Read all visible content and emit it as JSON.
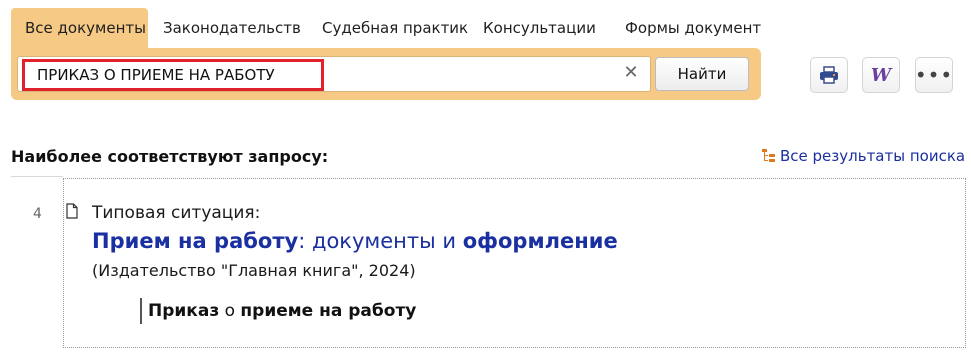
{
  "tabs": [
    {
      "label": "Все документы",
      "active": true
    },
    {
      "label": "Законодательств",
      "active": false
    },
    {
      "label": "Судебная практик",
      "active": false
    },
    {
      "label": "Консультации",
      "active": false
    },
    {
      "label": "Формы документ",
      "active": false
    }
  ],
  "search": {
    "value": "ПРИКАЗ О ПРИЕМЕ НА РАБОТУ",
    "clear_icon": "close-icon",
    "find_label": "Найти"
  },
  "toolbar": {
    "print_icon": "printer-icon",
    "word_icon": "word-export-icon",
    "word_glyph": "W",
    "more_icon": "more-dots-icon",
    "more_glyph": "•••"
  },
  "results": {
    "title": "Наиболее соответствуют запросу:",
    "all_results_label": "Все результаты поиска",
    "items": [
      {
        "number": "4",
        "kind": "Типовая ситуация:",
        "title_parts": [
          {
            "text": "Прием на работу",
            "bold": true
          },
          {
            "text": ": документы и ",
            "bold": false
          },
          {
            "text": "оформление",
            "bold": true
          }
        ],
        "source": "(Издательство \"Главная книга\", 2024)",
        "fragment_parts": [
          {
            "text": "Приказ",
            "bold": true
          },
          {
            "text": " о ",
            "bold": false
          },
          {
            "text": "приеме на работу",
            "bold": true
          }
        ]
      }
    ]
  },
  "colors": {
    "accent": "#f6c985",
    "link": "#1a2fa0",
    "highlight_border": "#e0222a"
  }
}
